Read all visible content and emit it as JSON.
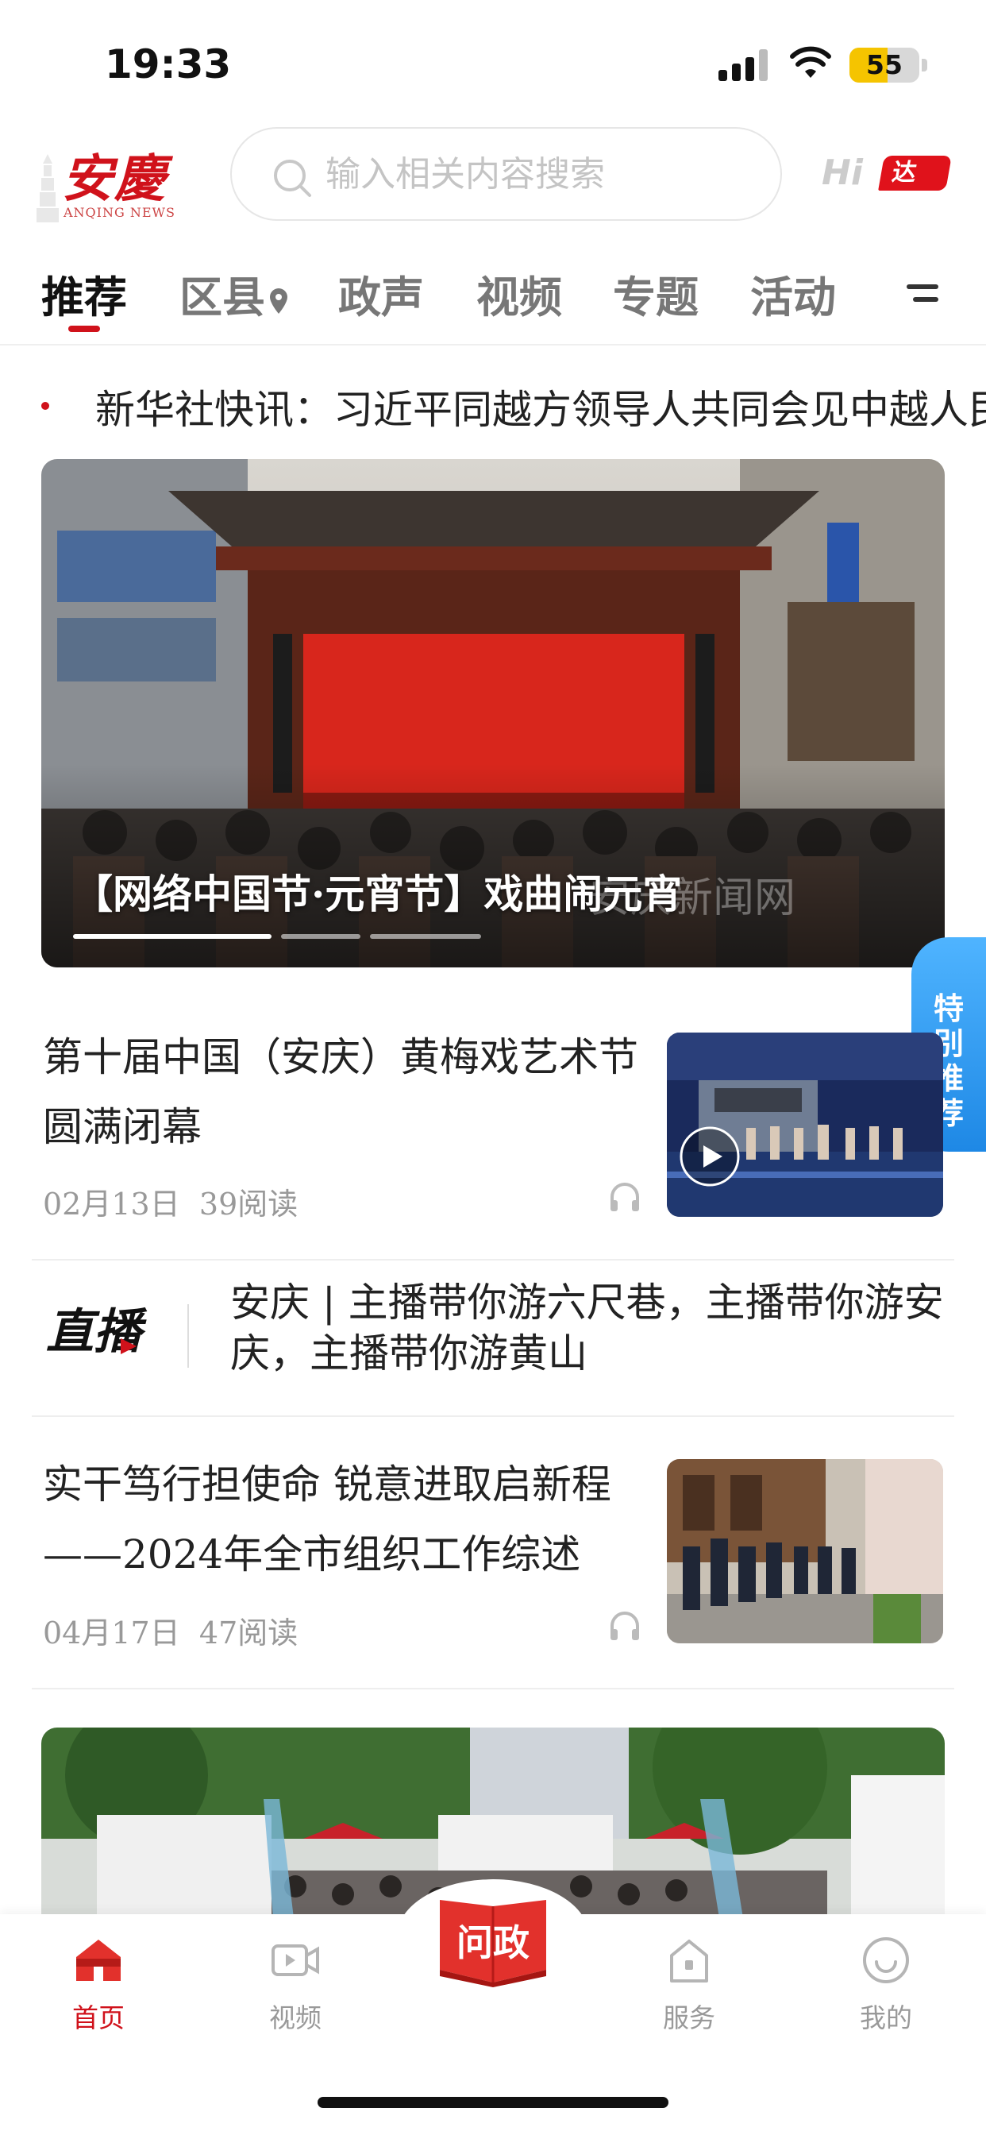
{
  "status_bar": {
    "time": "19:33",
    "battery": "55",
    "battery_level": 0.55,
    "battery_color": "#f5c400"
  },
  "header": {
    "logo_text": "安慶",
    "logo_subtext": "ANQING NEWS",
    "search_placeholder": "输入相关内容搜索",
    "hi_text": "Hi",
    "hi_tag": "达人",
    "accent_color": "#d0121b"
  },
  "tabs": [
    {
      "label": "推荐",
      "active": true
    },
    {
      "label": "区县",
      "icon": "location-pin-icon"
    },
    {
      "label": "政声"
    },
    {
      "label": "视频"
    },
    {
      "label": "专题"
    },
    {
      "label": "活动"
    }
  ],
  "ticker": {
    "text": "新华社快讯：习近平同越方领导人共同会见中越人民"
  },
  "banner": {
    "caption": "【网络中国节·元宵节】戏曲闹元宵",
    "watermark": "安庆新闻网",
    "slide_count": 3,
    "active_slide": 1
  },
  "side_tag": {
    "label": "特别推荐"
  },
  "news": [
    {
      "title": "第十届中国（安庆）黄梅戏艺术节圆满闭幕",
      "date": "02月13日",
      "reads": "39阅读",
      "has_video": true
    },
    {
      "title": "实干笃行担使命 锐意进取启新程——2024年全市组织工作综述",
      "date": "04月17日",
      "reads": "47阅读",
      "has_video": false
    }
  ],
  "live": {
    "logo": "直播",
    "text": "安庆 | 主播带你游六尺巷，主播带你游安庆，主播带你游黄山"
  },
  "bottom_nav": [
    {
      "label": "首页",
      "icon": "home-icon",
      "active": true
    },
    {
      "label": "视频",
      "icon": "video-icon"
    },
    {
      "label": "问政",
      "icon": "open-book-icon",
      "center": true
    },
    {
      "label": "服务",
      "icon": "service-bag-icon"
    },
    {
      "label": "我的",
      "icon": "smile-face-icon"
    }
  ]
}
